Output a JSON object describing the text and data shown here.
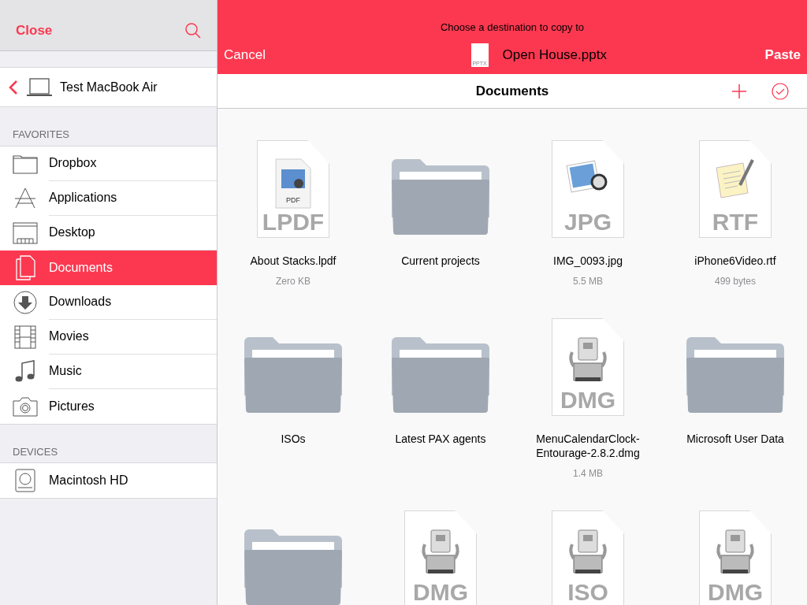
{
  "sidebar": {
    "close": "Close",
    "device": "Test MacBook Air",
    "sections": [
      {
        "heading": "FAVORITES",
        "items": [
          {
            "label": "Dropbox",
            "selected": false
          },
          {
            "label": "Applications",
            "selected": false
          },
          {
            "label": "Desktop",
            "selected": false
          },
          {
            "label": "Documents",
            "selected": true
          },
          {
            "label": "Downloads",
            "selected": false
          },
          {
            "label": "Movies",
            "selected": false
          },
          {
            "label": "Music",
            "selected": false
          },
          {
            "label": "Pictures",
            "selected": false
          }
        ]
      },
      {
        "heading": "DEVICES",
        "items": [
          {
            "label": "Macintosh HD",
            "selected": false
          }
        ]
      }
    ]
  },
  "header": {
    "prompt": "Choose a destination to copy to",
    "cancel": "Cancel",
    "file": {
      "name": "Open House.pptx",
      "type": "PPTX"
    },
    "paste": "Paste"
  },
  "folder": {
    "title": "Documents"
  },
  "files": [
    {
      "kind": "pdf",
      "type": "LPDF",
      "preview_label": "PDF",
      "name": "About Stacks.lpdf",
      "size": "Zero KB"
    },
    {
      "kind": "folder",
      "name": "Current projects"
    },
    {
      "kind": "image",
      "type": "JPG",
      "name": "IMG_0093.jpg",
      "size": "5.5 MB"
    },
    {
      "kind": "text",
      "type": "RTF",
      "name": "iPhone6Video.rtf",
      "size": "499 bytes"
    },
    {
      "kind": "folder",
      "name": "ISOs"
    },
    {
      "kind": "folder",
      "name": "Latest PAX agents"
    },
    {
      "kind": "disk",
      "type": "DMG",
      "name": "MenuCalendarClock-Entourage-2.8.2.dmg",
      "size": "1.4 MB"
    },
    {
      "kind": "folder",
      "name": "Microsoft User Data"
    },
    {
      "kind": "folder"
    },
    {
      "kind": "disk",
      "type": "DMG"
    },
    {
      "kind": "disk",
      "type": "ISO"
    },
    {
      "kind": "disk",
      "type": "DMG"
    }
  ]
}
